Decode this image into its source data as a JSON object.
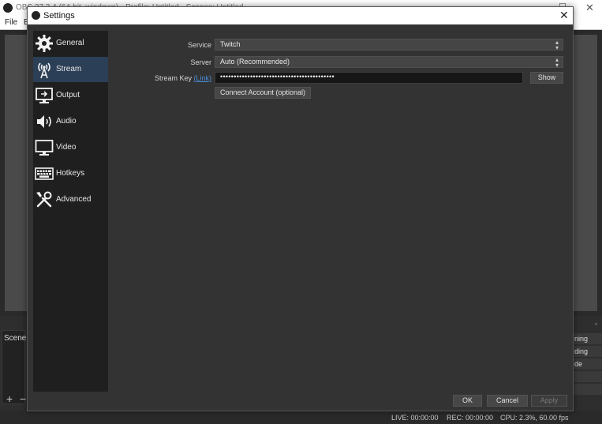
{
  "background": {
    "app_title": "OBS 27.2.4 (64-bit, windows) - Profile: Untitled - Scenes: Untitled",
    "menu": {
      "file": "File",
      "edit": "E"
    },
    "scenes_label": "Scene",
    "add_glyph": "+",
    "remove_glyph": "−",
    "controls": [
      "ning",
      "ding",
      "de",
      "",
      ""
    ],
    "status": {
      "live": "LIVE: 00:00:00",
      "rec": "REC: 00:00:00",
      "cpu": "CPU: 2.3%, 60.00 fps"
    }
  },
  "dialog": {
    "title": "Settings",
    "close_glyph": "✕",
    "sidebar": [
      {
        "label": "General",
        "icon": "gear-icon"
      },
      {
        "label": "Stream",
        "icon": "antenna-icon",
        "active": true
      },
      {
        "label": "Output",
        "icon": "output-icon"
      },
      {
        "label": "Audio",
        "icon": "speaker-icon"
      },
      {
        "label": "Video",
        "icon": "monitor-icon"
      },
      {
        "label": "Hotkeys",
        "icon": "keyboard-icon"
      },
      {
        "label": "Advanced",
        "icon": "tools-icon"
      }
    ],
    "stream": {
      "service_label": "Service",
      "service_value": "Twitch",
      "server_label": "Server",
      "server_value": "Auto (Recommended)",
      "key_label": "Stream Key",
      "key_link": "(Link)",
      "key_value": "••••••••••••••••••••••••••••••••••••••••••",
      "show_button": "Show",
      "connect_button": "Connect Account (optional)"
    },
    "buttons": {
      "ok": "OK",
      "cancel": "Cancel",
      "apply": "Apply"
    }
  },
  "colors": {
    "accent_selected": "#2b3f57",
    "link": "#4a8fdc",
    "dialog_bg": "#333333",
    "sidebar_bg": "#1f1f1f"
  }
}
